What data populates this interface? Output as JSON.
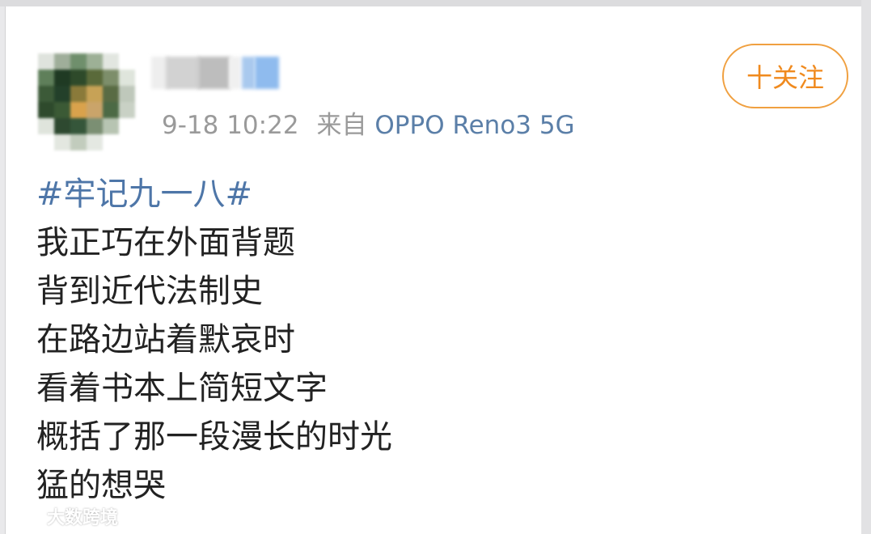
{
  "post": {
    "timestamp": "9-18 10:22",
    "source_prefix": "来自",
    "source_device": "OPPO Reno3 5G",
    "follow_label": "十关注",
    "hashtag": "#牢记九一八#",
    "lines": [
      "我正巧在外面背题",
      "背到近代法制史",
      "在路边站着默哀时",
      "看着书本上简短文字",
      "概括了那一段漫长的时光",
      "猛的想哭"
    ]
  },
  "watermark": {
    "text": "大数跨境",
    "icon": "brand-logo-icon"
  },
  "colors": {
    "link": "#4e76a8",
    "follow": "#f08a1e",
    "follow_border": "#f0a040",
    "text": "#222222",
    "meta": "#9a9a9a"
  }
}
